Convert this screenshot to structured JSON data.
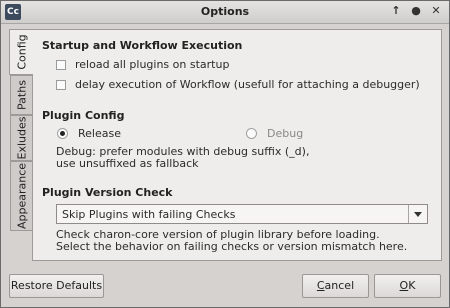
{
  "window": {
    "title": "Options",
    "app_icon_text": "Cc",
    "controls": {
      "pin": "↑",
      "maximize": "●",
      "close": "✕"
    }
  },
  "tabs": [
    "Config",
    "Paths",
    "Exludes",
    "Appearance"
  ],
  "startup": {
    "title": "Startup and Workflow Execution",
    "options": [
      {
        "label": "reload all plugins on startup",
        "checked": false
      },
      {
        "label": "delay execution of Workflow (usefull for attaching a debugger)",
        "checked": false
      }
    ]
  },
  "plugin_config": {
    "title": "Plugin Config",
    "release_label": "Release",
    "debug_label": "Debug",
    "selected": "Release",
    "description": "Debug: prefer modules with debug suffix (_d),\nuse unsuffixed as fallback"
  },
  "version_check": {
    "title": "Plugin Version Check",
    "selected": "Skip Plugins with failing Checks",
    "description": "Check charon-core version of plugin library before loading.\nSelect the behavior on failing checks or version mismatch here."
  },
  "buttons": {
    "restore": "Restore Defaults",
    "cancel_pre": "",
    "cancel_ul": "C",
    "cancel_post": "ancel",
    "ok_pre": "",
    "ok_ul": "O",
    "ok_post": "K"
  }
}
